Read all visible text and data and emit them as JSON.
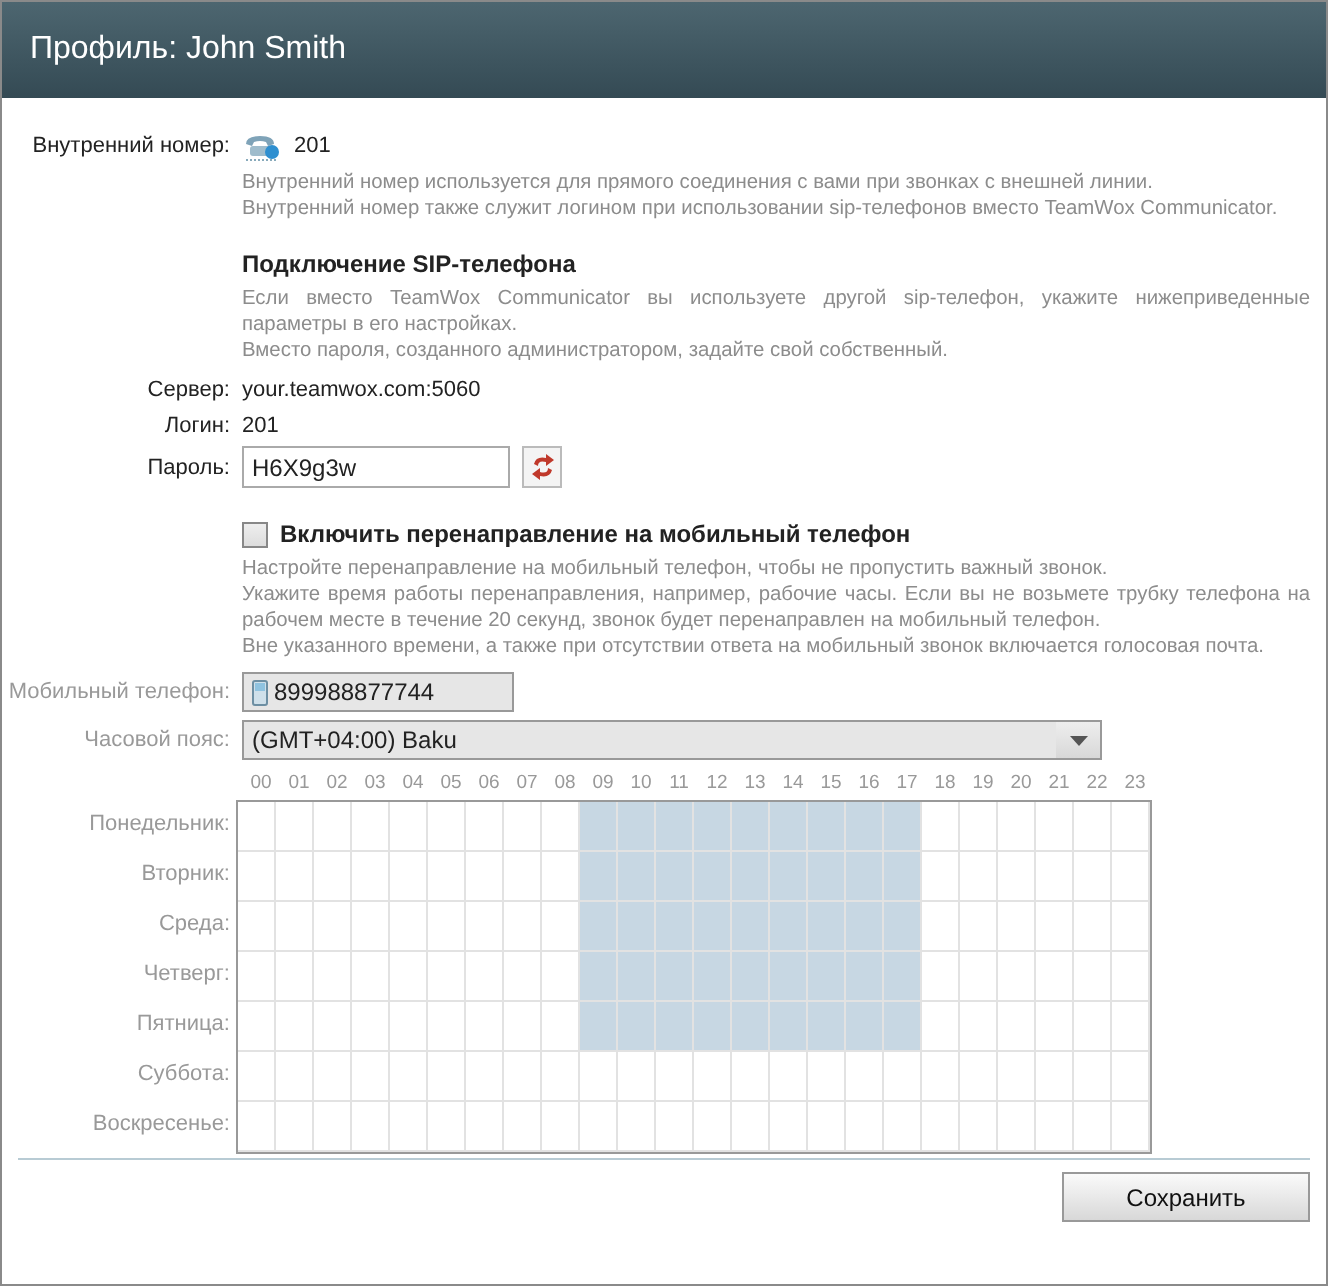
{
  "window": {
    "title": "Профиль: John Smith"
  },
  "extension": {
    "label": "Внутренний номер:",
    "value": "201",
    "notes": [
      "Внутренний номер используется для прямого соединения с вами при звонках с внешней линии.",
      "Внутренний номер также служит логином при использовании sip-телефонов вместо TeamWox Communicator."
    ]
  },
  "sip": {
    "heading": "Подключение SIP-телефона",
    "notes": [
      "Если вместо TeamWox Communicator вы используете другой sip-телефон, укажите нижеприведенные параметры в его настройках.",
      "Вместо пароля, созданного администратором, задайте свой собственный."
    ],
    "fields": [
      {
        "kind": "text",
        "label": "Сервер:",
        "value": "your.teamwox.com:5060"
      },
      {
        "kind": "text",
        "label": "Логин:",
        "value": "201"
      },
      {
        "kind": "input",
        "label": "Пароль:",
        "value": "H6X9g3w"
      }
    ]
  },
  "forwarding": {
    "label": "Включить перенаправление на мобильный телефон",
    "checked": false,
    "notes": [
      "Настройте перенаправление на мобильный телефон, чтобы не пропустить важный звонок.",
      "Укажите время работы перенаправления, например, рабочие часы. Если вы не возьмете трубку телефона на рабочем месте в течение 20 секунд, звонок будет перенаправлен на мобильный телефон.",
      "Вне указанного времени, а также при отсутствии ответа на мобильный звонок включается голосовая почта."
    ],
    "mobile": {
      "label": "Мобильный телефон:",
      "value": "899988877744"
    },
    "timezone": {
      "label": "Часовой пояс:",
      "value": "(GMT+04:00) Baku"
    }
  },
  "schedule": {
    "hours": [
      "00",
      "01",
      "02",
      "03",
      "04",
      "05",
      "06",
      "07",
      "08",
      "09",
      "10",
      "11",
      "12",
      "13",
      "14",
      "15",
      "16",
      "17",
      "18",
      "19",
      "20",
      "21",
      "22",
      "23"
    ],
    "days": [
      {
        "label": "Понедельник:",
        "active": [
          false,
          false,
          false,
          false,
          false,
          false,
          false,
          false,
          false,
          true,
          true,
          true,
          true,
          true,
          true,
          true,
          true,
          true,
          false,
          false,
          false,
          false,
          false,
          false
        ]
      },
      {
        "label": "Вторник:",
        "active": [
          false,
          false,
          false,
          false,
          false,
          false,
          false,
          false,
          false,
          true,
          true,
          true,
          true,
          true,
          true,
          true,
          true,
          true,
          false,
          false,
          false,
          false,
          false,
          false
        ]
      },
      {
        "label": "Среда:",
        "active": [
          false,
          false,
          false,
          false,
          false,
          false,
          false,
          false,
          false,
          true,
          true,
          true,
          true,
          true,
          true,
          true,
          true,
          true,
          false,
          false,
          false,
          false,
          false,
          false
        ]
      },
      {
        "label": "Четверг:",
        "active": [
          false,
          false,
          false,
          false,
          false,
          false,
          false,
          false,
          false,
          true,
          true,
          true,
          true,
          true,
          true,
          true,
          true,
          true,
          false,
          false,
          false,
          false,
          false,
          false
        ]
      },
      {
        "label": "Пятница:",
        "active": [
          false,
          false,
          false,
          false,
          false,
          false,
          false,
          false,
          false,
          true,
          true,
          true,
          true,
          true,
          true,
          true,
          true,
          true,
          false,
          false,
          false,
          false,
          false,
          false
        ]
      },
      {
        "label": "Суббота:",
        "active": [
          false,
          false,
          false,
          false,
          false,
          false,
          false,
          false,
          false,
          false,
          false,
          false,
          false,
          false,
          false,
          false,
          false,
          false,
          false,
          false,
          false,
          false,
          false,
          false
        ]
      },
      {
        "label": "Воскресенье:",
        "active": [
          false,
          false,
          false,
          false,
          false,
          false,
          false,
          false,
          false,
          false,
          false,
          false,
          false,
          false,
          false,
          false,
          false,
          false,
          false,
          false,
          false,
          false,
          false,
          false
        ]
      }
    ]
  },
  "buttons": [
    "Сохранить"
  ]
}
